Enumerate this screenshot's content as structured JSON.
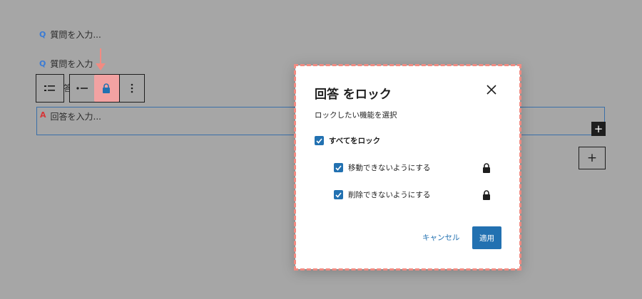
{
  "editor": {
    "question_placeholder_1": "質問を入力...",
    "question_placeholder_2": "質問を入力",
    "question_marker": "Q",
    "answer_marker": "A",
    "answer_placeholder": "回答を入力...",
    "toolbar_partial_text": "答",
    "plus_label": "+"
  },
  "toolbar": {
    "icons": [
      "list-icon",
      "move-icon",
      "lock-icon",
      "more-vertical-icon"
    ]
  },
  "modal": {
    "title": "回答 をロック",
    "subtitle": "ロックしたい機能を選択",
    "lock_all_label": "すべてをロック",
    "lock_all_checked": true,
    "options": [
      {
        "label": "移動できないようにする",
        "checked": true,
        "icon": "lock-icon"
      },
      {
        "label": "削除できないようにする",
        "checked": true,
        "icon": "lock-icon"
      }
    ],
    "cancel_label": "キャンセル",
    "apply_label": "適用"
  },
  "colors": {
    "overlay": "#a6a6a6",
    "accent": "#2271b1",
    "highlight": "#f28b82",
    "answer_marker": "#d63638",
    "question_marker": "#3a7bd5"
  }
}
